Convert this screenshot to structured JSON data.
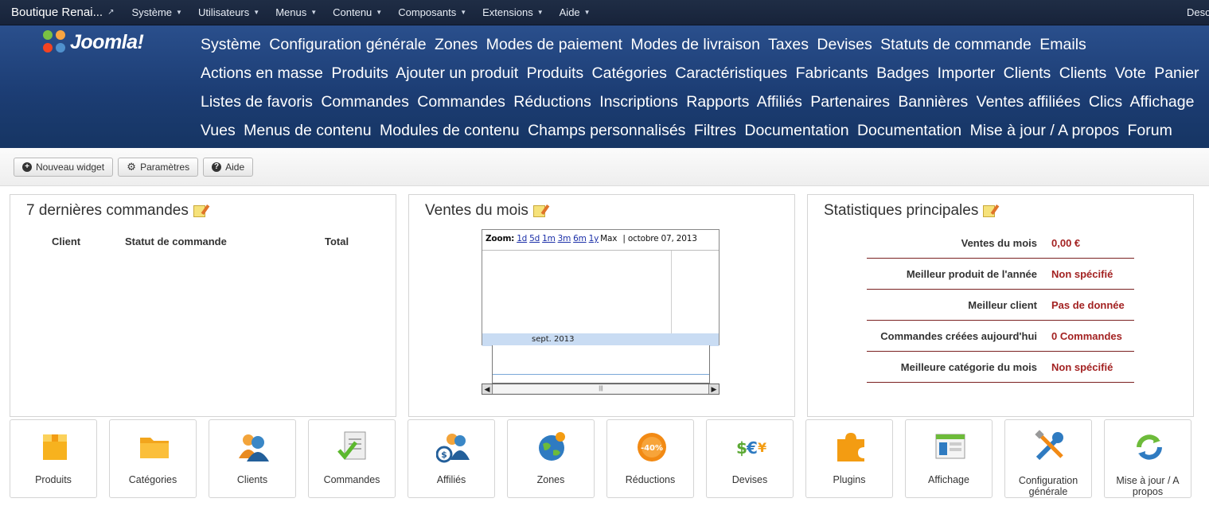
{
  "topbar": {
    "brand": "Boutique Renai...",
    "menus": [
      "Système",
      "Utilisateurs",
      "Menus",
      "Contenu",
      "Composants",
      "Extensions",
      "Aide"
    ],
    "right_text": "Desc"
  },
  "logo": {
    "word": "Joomla!"
  },
  "submenu": [
    "Système",
    "Configuration générale",
    "Zones",
    "Modes de paiement",
    "Modes de livraison",
    "Taxes",
    "Devises",
    "Statuts de commande",
    "Emails",
    "Actions en masse",
    "Produits",
    "Ajouter un produit",
    "Produits",
    "Catégories",
    "Caractéristiques",
    "Fabricants",
    "Badges",
    "Importer",
    "Clients",
    "Clients",
    "Vote",
    "Panier",
    "Listes de favoris",
    "Commandes",
    "Commandes",
    "Réductions",
    "Inscriptions",
    "Rapports",
    "Affiliés",
    "Partenaires",
    "Bannières",
    "Ventes affiliées",
    "Clics",
    "Affichage",
    "Vues",
    "Menus de contenu",
    "Modules de contenu",
    "Champs personnalisés",
    "Filtres",
    "Documentation",
    "Documentation",
    "Mise à jour / A propos",
    "Forum"
  ],
  "toolbar": {
    "new_widget": "Nouveau widget",
    "params": "Paramètres",
    "help": "Aide"
  },
  "orders": {
    "title": "7 dernières commandes",
    "columns": [
      "Client",
      "Statut de commande",
      "Total"
    ]
  },
  "sales": {
    "title": "Ventes du mois",
    "zoom_label": "Zoom:",
    "zoom_links": [
      "1d",
      "5d",
      "1m",
      "3m",
      "6m",
      "1y",
      "Max"
    ],
    "date": "octobre 07, 2013",
    "band_label": "sept. 2013"
  },
  "stats": {
    "title": "Statistiques principales",
    "rows": [
      {
        "k": "Ventes du mois",
        "v": "0,00 €"
      },
      {
        "k": "Meilleur produit de l'année",
        "v": "Non spécifié"
      },
      {
        "k": "Meilleur client",
        "v": "Pas de donnée"
      },
      {
        "k": "Commandes créées aujourd'hui",
        "v": "0 Commandes"
      },
      {
        "k": "Meilleure catégorie du mois",
        "v": "Non spécifié"
      }
    ]
  },
  "tiles": [
    "Produits",
    "Catégories",
    "Clients",
    "Commandes",
    "Affiliés",
    "Zones",
    "Réductions",
    "Devises",
    "Plugins",
    "Affichage",
    "Configuration générale",
    "Mise à jour / A propos"
  ],
  "colors": {
    "accent": "#a32222",
    "header": "#1c3d74",
    "topbar": "#1f2d45"
  }
}
